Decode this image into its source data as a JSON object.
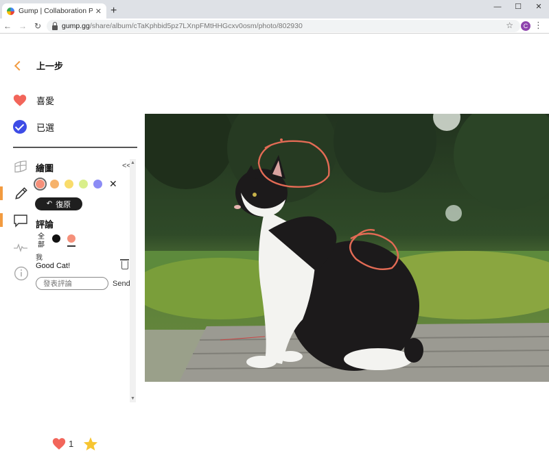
{
  "browser": {
    "tab_title": "Gump | Collaboration Platform",
    "tab_close": "✕",
    "new_tab": "+",
    "window": {
      "minimize": "—",
      "maximize": "☐",
      "close": "✕"
    },
    "url_host": "gump.gg",
    "url_path": "/share/album/cTaKphbid5pz7LXnpFMtHHGcxv0osm/photo/802930",
    "profile_initial": "C"
  },
  "panel": {
    "back_label": "上一步",
    "favorite_label": "喜愛",
    "selected_label": "已選",
    "draw_title": "繪圖",
    "collapse_glyph": "<<",
    "colors": [
      "#f5907a",
      "#f6b26b",
      "#f9dc6b",
      "#d9ef8b",
      "#8c8cf5"
    ],
    "selected_color": "#f5907a",
    "undo_label": "復原",
    "comment_title": "評論",
    "filter_all": "全部",
    "filter_dots": [
      "#111111",
      "#f5907a"
    ],
    "comment_author": "我",
    "comment_text": "Good Cat!",
    "input_placeholder": "發表評論",
    "send_label": "Send"
  },
  "footer": {
    "like_count": "1"
  },
  "accent_color": "#f29b40",
  "heart_color": "#f2655a",
  "check_color": "#3d4ce6",
  "star_color": "#f7c531"
}
